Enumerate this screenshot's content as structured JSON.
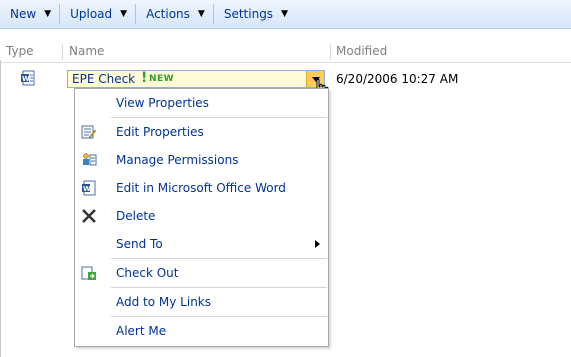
{
  "toolbar": {
    "new_label": "New",
    "upload_label": "Upload",
    "actions_label": "Actions",
    "settings_label": "Settings"
  },
  "columns": {
    "type": "Type",
    "name": "Name",
    "modified": "Modified"
  },
  "item": {
    "name": "EPE Check",
    "exclaim": "!",
    "new_badge": "NEW",
    "modified": "6/20/2006 10:27 AM"
  },
  "menu": {
    "items": [
      {
        "label": "View Properties",
        "icon": "none"
      },
      {
        "label": "Edit Properties",
        "icon": "edit-properties-icon"
      },
      {
        "label": "Manage Permissions",
        "icon": "permissions-icon"
      },
      {
        "label": "Edit in Microsoft Office Word",
        "icon": "word-icon"
      },
      {
        "label": "Delete",
        "icon": "delete-x-icon"
      },
      {
        "label": "Send To",
        "icon": "none"
      },
      {
        "label": "Check Out",
        "icon": "check-out-icon"
      },
      {
        "label": "Add to My Links",
        "icon": "none"
      },
      {
        "label": "Alert Me",
        "icon": "none"
      }
    ]
  },
  "colors": {
    "link": "#003399",
    "toolbar_top": "#eef5fd",
    "toolbar_bottom": "#d6e7fa",
    "new_green": "#2f9e2f",
    "highlight": "#fffbd6",
    "dropdown": "#fccb5c"
  }
}
